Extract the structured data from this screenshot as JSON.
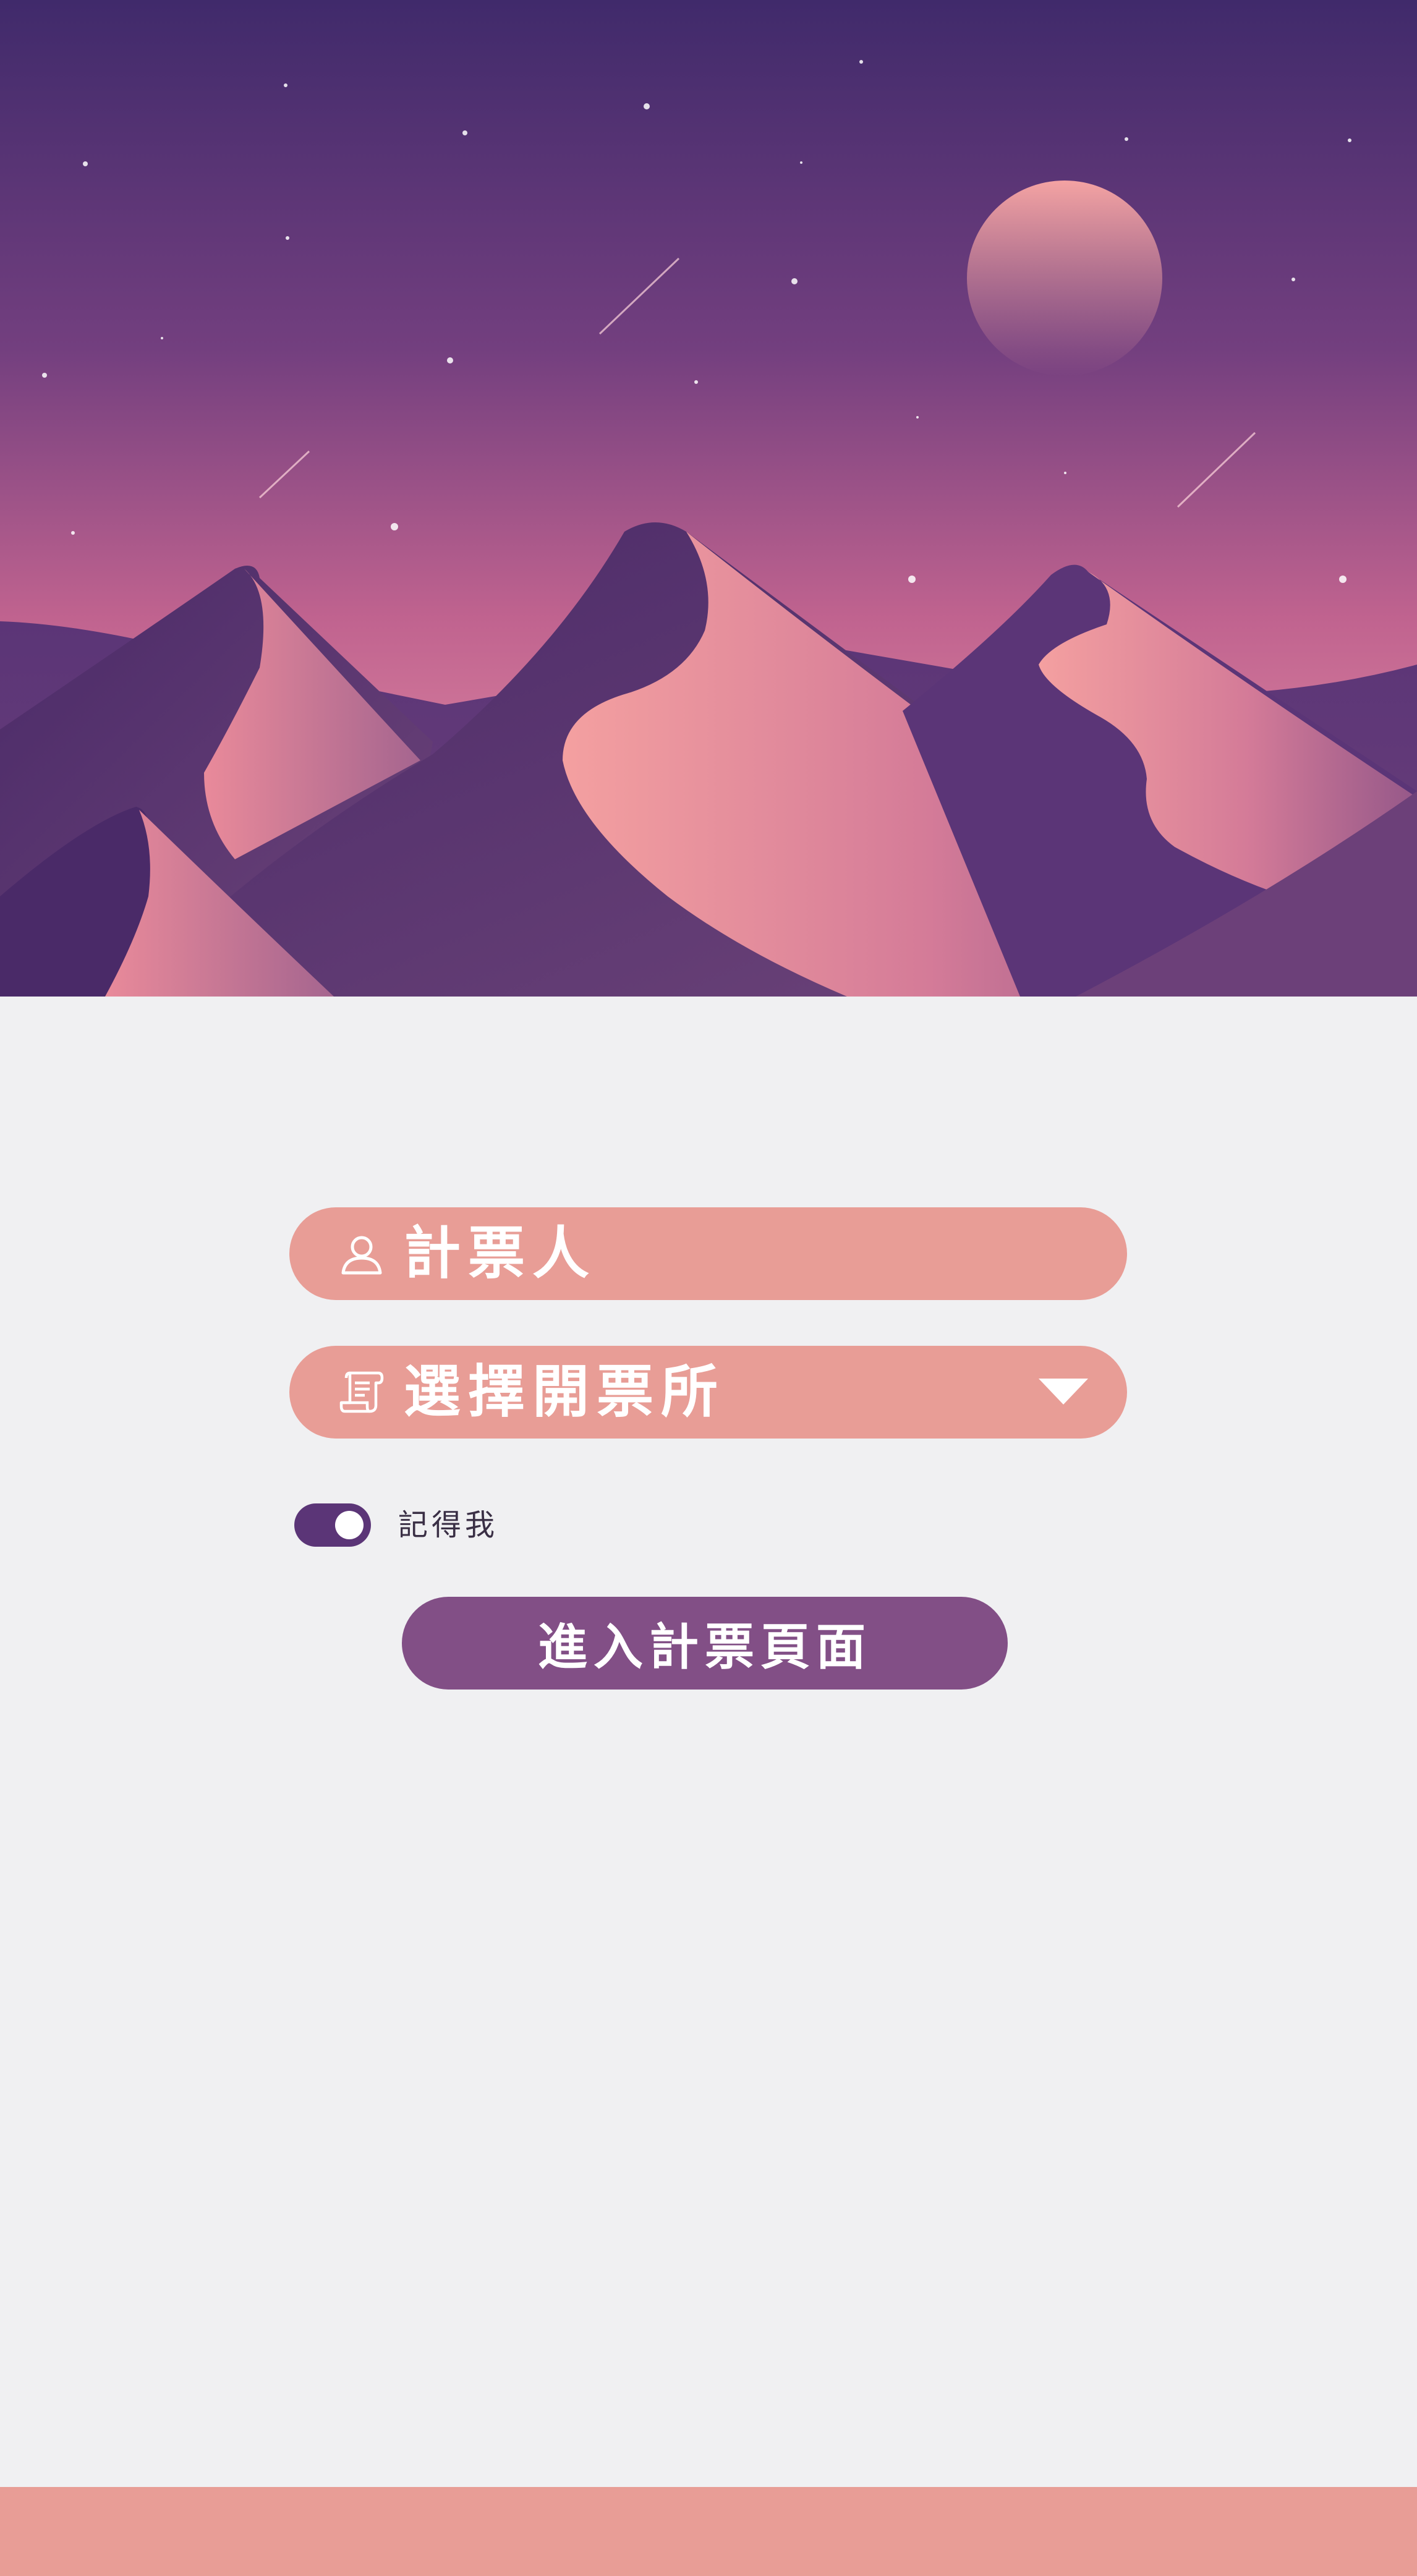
{
  "hero": {
    "scene": "desert-dunes-night-illustration"
  },
  "form": {
    "user_field": {
      "label": "計票人",
      "icon": "user-icon"
    },
    "station_field": {
      "label": "選擇開票所",
      "icon": "scroll-document-icon",
      "caret_icon": "triangle-down-icon"
    },
    "remember": {
      "label": "記得我",
      "checked": true
    },
    "submit_label": "進入計票頁面"
  },
  "colors": {
    "background": "#f0f0f2",
    "field": "#e89d96",
    "toggle": "#5b3577",
    "button": "#824f86",
    "footer": "#e89d96"
  }
}
